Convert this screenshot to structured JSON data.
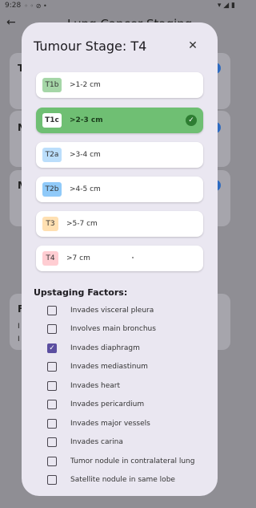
{
  "status": {
    "time": "9:28",
    "icons": "◦ ◦ ⊘ •",
    "right": "▾ ◢ ▮"
  },
  "appbar": {
    "title": "Lung Cancer Staging"
  },
  "background": {
    "letters": [
      "T",
      "N",
      "M",
      "F"
    ],
    "sub": [
      "I",
      "I"
    ]
  },
  "dialog": {
    "title": "Tumour Stage: T4",
    "close_icon": "✕",
    "stages": [
      {
        "code": "T1b",
        "size": ">1-2 cm",
        "badge_color": "#a5d6a7"
      },
      {
        "code": "T1c",
        "size": ">2-3 cm",
        "badge_color": "#ffffff",
        "selected": true
      },
      {
        "code": "T2a",
        "size": ">3-4 cm",
        "badge_color": "#bbdefb"
      },
      {
        "code": "T2b",
        "size": ">4-5 cm",
        "badge_color": "#90caf9"
      },
      {
        "code": "T3",
        "size": ">5-7 cm",
        "badge_color": "#ffe0b2"
      },
      {
        "code": "T4",
        "size": ">7 cm",
        "badge_color": "#ffcdd2"
      }
    ],
    "check_icon": "✓",
    "factors_title": "Upstaging Factors:",
    "factors": [
      {
        "label": "Invades visceral pleura",
        "checked": false
      },
      {
        "label": "Involves main bronchus",
        "checked": false
      },
      {
        "label": "Invades diaphragm",
        "checked": true
      },
      {
        "label": "Invades mediastinum",
        "checked": false
      },
      {
        "label": "Invades heart",
        "checked": false
      },
      {
        "label": "Invades pericardium",
        "checked": false
      },
      {
        "label": "Invades major vessels",
        "checked": false
      },
      {
        "label": "Invades carina",
        "checked": false
      },
      {
        "label": "Tumor nodule in contralateral lung",
        "checked": false
      },
      {
        "label": "Satellite nodule in same lobe",
        "checked": false
      }
    ]
  }
}
